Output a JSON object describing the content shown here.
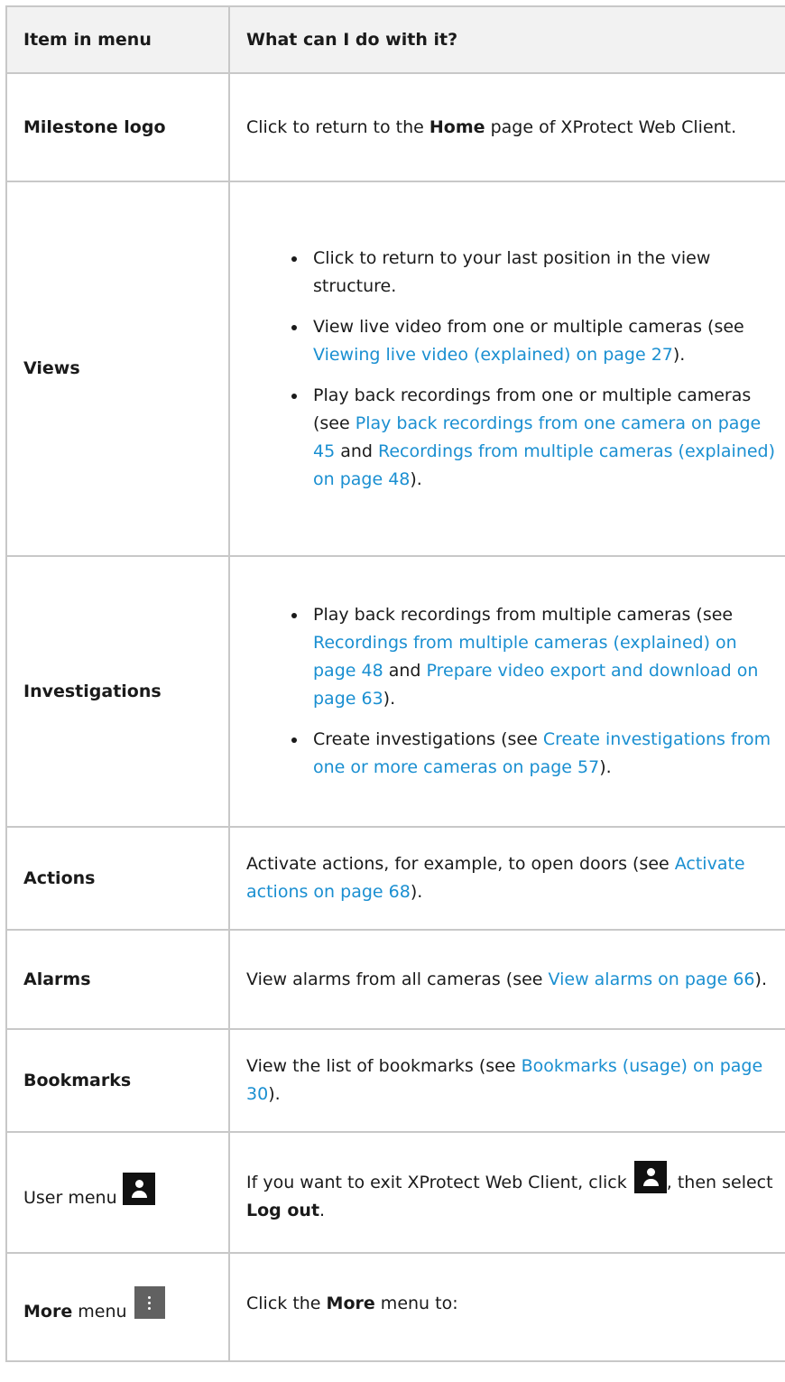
{
  "headers": {
    "col1": "Item in menu",
    "col2": "What can I do with it?"
  },
  "rows": {
    "milestone": {
      "item": "Milestone logo",
      "p1": "Click to return to the ",
      "b1": "Home",
      "p2": " page of XProtect Web Client."
    },
    "views": {
      "item": "Views",
      "bullet1": "Click to return to your last position in the view structure.",
      "bullet2_pre": "View live video from one or multiple cameras (see ",
      "bullet2_link": "Viewing live video (explained) on page 27",
      "bullet2_post": ").",
      "bullet3_pre": "Play back recordings from one or multiple cameras (see ",
      "bullet3_link1": "Play back recordings from one camera on page 45",
      "bullet3_mid": " and ",
      "bullet3_link2": "Recordings from multiple cameras (explained) on page 48",
      "bullet3_post": ")."
    },
    "investigations": {
      "item": "Investigations",
      "bullet1_pre": "Play back recordings from multiple cameras (see ",
      "bullet1_link1": "Recordings from multiple cameras (explained) on page 48",
      "bullet1_mid": " and ",
      "bullet1_link2": "Prepare video export and download on page 63",
      "bullet1_post": ").",
      "bullet2_pre": "Create investigations (see ",
      "bullet2_link": "Create investigations from one or more cameras on page 57",
      "bullet2_post": ")."
    },
    "actions": {
      "item": "Actions",
      "pre": "Activate actions, for example, to open doors (see ",
      "link": "Activate actions on page 68",
      "post": ")."
    },
    "alarms": {
      "item": "Alarms",
      "pre": "View alarms from all cameras (see ",
      "link": "View alarms on page 66",
      "post": ")."
    },
    "bookmarks": {
      "item": "Bookmarks",
      "pre": "View the list of bookmarks (see ",
      "link": "Bookmarks (usage) on page 30",
      "post": ")."
    },
    "user_menu": {
      "item": "User menu",
      "icon": "user-icon",
      "pre": "If you want to exit XProtect Web Client, click ",
      "mid": ", then select ",
      "bold": "Log out",
      "post": "."
    },
    "more_menu": {
      "item_bold": "More",
      "item_rest": " menu",
      "icon": "more-vertical-icon",
      "pre": "Click the ",
      "bold": "More",
      "post": " menu to:"
    }
  },
  "colors": {
    "link": "#1a8fd1",
    "header_bg": "#f2f2f2",
    "border": "#c8c8c8"
  }
}
